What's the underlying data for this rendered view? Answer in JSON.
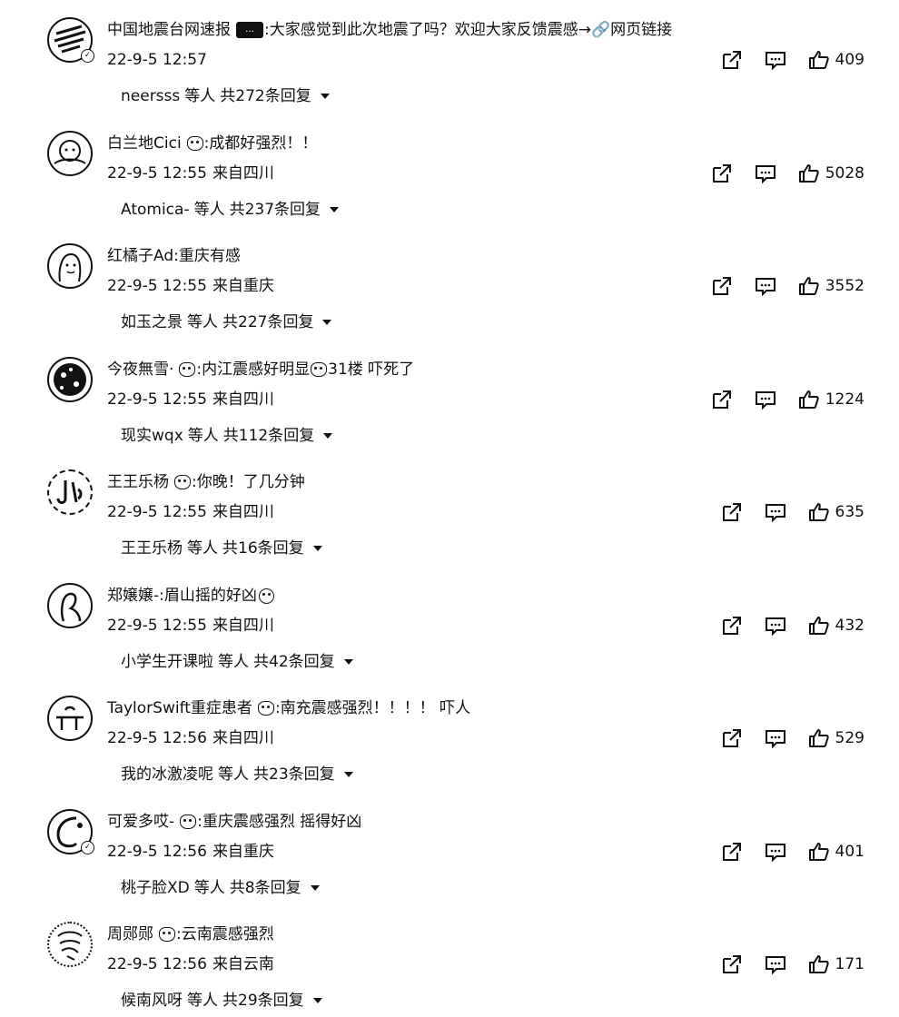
{
  "comments": [
    {
      "username": "中国地震台网速报",
      "emoji": "tag-badge",
      "text": ":大家感觉到此次地震了吗？欢迎大家反馈震感→🔗网页链接",
      "timestamp": "22-9-5 12:57",
      "location": "",
      "likes": "409",
      "reply_user": "neersss",
      "reply_suffix": "等人",
      "reply_count": "共272条回复",
      "verified": true
    },
    {
      "username": "白兰地Cici",
      "emoji": "cry-face",
      "text": ":成都好强烈！！",
      "timestamp": "22-9-5 12:55",
      "location": "来自四川",
      "likes": "5028",
      "reply_user": "Atomica-",
      "reply_suffix": "等人",
      "reply_count": "共237条回复",
      "verified": false
    },
    {
      "username": "红橘子Ad",
      "emoji": "",
      "text": ":重庆有感",
      "timestamp": "22-9-5 12:55",
      "location": "来自重庆",
      "likes": "3552",
      "reply_user": "如玉之景",
      "reply_suffix": "等人",
      "reply_count": "共227条回复",
      "verified": false
    },
    {
      "username": "今夜無雪·",
      "emoji": "cry-face",
      "text": ":内江震感好明显",
      "text_tail": "31楼 吓死了",
      "emoji_tail": "cry-face",
      "timestamp": "22-9-5 12:55",
      "location": "来自四川",
      "likes": "1224",
      "reply_user": "现实wqx",
      "reply_suffix": "等人",
      "reply_count": "共112条回复",
      "verified": false
    },
    {
      "username": "王王乐杨",
      "emoji": "cry-face",
      "text": ":你晚！了几分钟",
      "timestamp": "22-9-5 12:55",
      "location": "来自四川",
      "likes": "635",
      "reply_user": "王王乐杨",
      "reply_suffix": "等人",
      "reply_count": "共16条回复",
      "verified": false
    },
    {
      "username": "郑嬢嬢-",
      "emoji": "",
      "text": ":眉山摇的好凶",
      "emoji_tail": "smile-face",
      "timestamp": "22-9-5 12:55",
      "location": "来自四川",
      "likes": "432",
      "reply_user": "小学生开课啦",
      "reply_suffix": "等人",
      "reply_count": "共42条回复",
      "verified": false
    },
    {
      "username": "TaylorSwift重症患者",
      "emoji": "cry-face",
      "text": ":南充震感强烈！！！！ 吓人",
      "timestamp": "22-9-5 12:56",
      "location": "来自四川",
      "likes": "529",
      "reply_user": "我的冰激凌呢",
      "reply_suffix": "等人",
      "reply_count": "共23条回复",
      "verified": false
    },
    {
      "username": "可爱多哎-",
      "emoji": "cry-face",
      "text": ":重庆震感强烈 摇得好凶",
      "timestamp": "22-9-5 12:56",
      "location": "来自重庆",
      "likes": "401",
      "reply_user": "桃子脸XD",
      "reply_suffix": "等人",
      "reply_count": "共8条回复",
      "verified": true
    },
    {
      "username": "周郧郧",
      "emoji": "cry-face",
      "text": ":云南震感强烈",
      "timestamp": "22-9-5 12:56",
      "location": "来自云南",
      "likes": "171",
      "reply_user": "候南风呀",
      "reply_suffix": "等人",
      "reply_count": "共29条回复",
      "verified": false
    }
  ],
  "icons": {
    "share": "share-icon",
    "comment": "comment-icon",
    "like": "like-icon",
    "expand": "caret-down-icon"
  }
}
